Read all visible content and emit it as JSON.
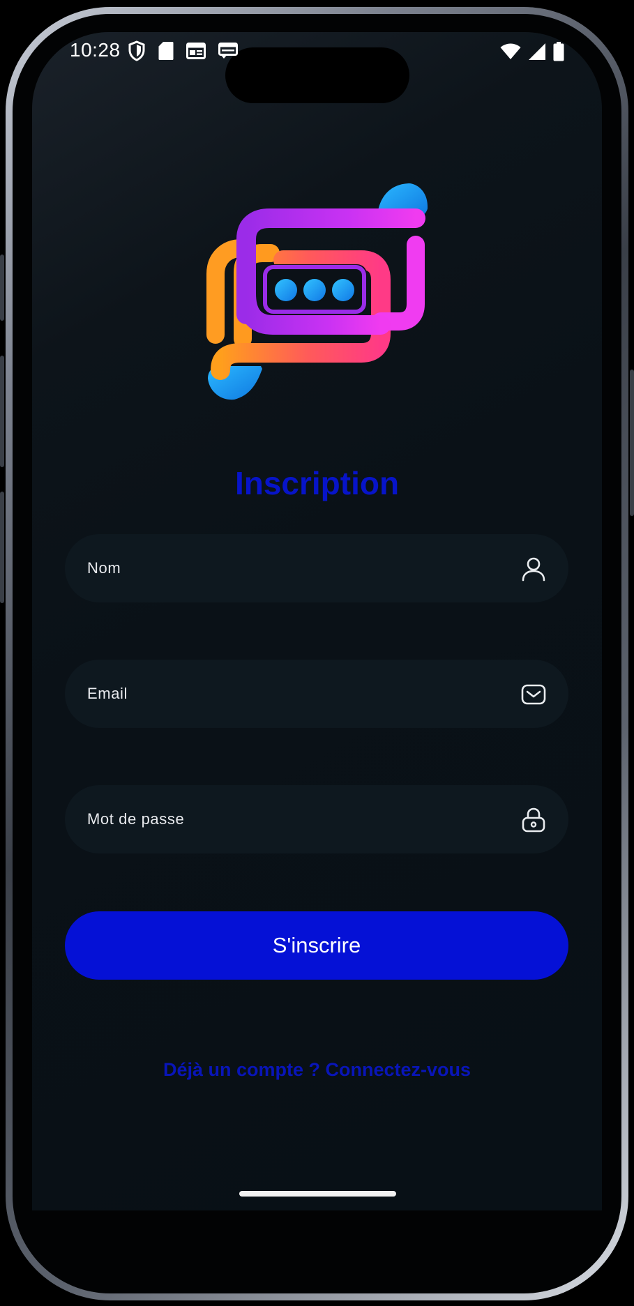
{
  "status_bar": {
    "time": "10:28",
    "left_icons": [
      "shield-icon",
      "sd-card-icon",
      "news-icon",
      "news-alt-icon"
    ],
    "right_icons": [
      "wifi-icon",
      "signal-icon",
      "battery-icon"
    ]
  },
  "logo": {
    "name": "chat-logo",
    "colors": {
      "orange": "#ff9a1f",
      "pink": "#ff3d7f",
      "purple": "#b02cf0",
      "magenta": "#e93cf5",
      "blue": "#1ea6f5"
    }
  },
  "page": {
    "title": "Inscription"
  },
  "form": {
    "name_label": "Nom",
    "email_label": "Email",
    "password_label": "Mot de passe",
    "submit_label": "S'inscrire",
    "login_link": "Déjà un compte ? Connectez-vous"
  },
  "colors": {
    "accent": "#0511d6",
    "title": "#0714c9",
    "field_bg": "#0e181f",
    "background": "#0a1117"
  }
}
